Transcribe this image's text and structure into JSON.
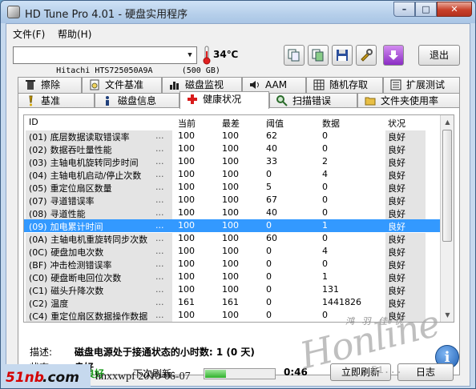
{
  "window": {
    "title": "HD Tune Pro 4.01 - 硬盘实用程序",
    "minimize": "–",
    "maximize": "□",
    "close": "✕"
  },
  "menu": {
    "file": "文件(F)",
    "help": "帮助(H)"
  },
  "toolbar": {
    "drive": "Hitachi HTS725050A9A      (500 GB)",
    "temperature": "34℃",
    "exit": "退出"
  },
  "tabs_top": [
    "擦除",
    "文件基准",
    "磁盘监视",
    "AAM",
    "随机存取",
    "扩展测试"
  ],
  "tabs_bottom": [
    "基准",
    "磁盘信息",
    "健康状况",
    "扫描错误",
    "文件夹使用率"
  ],
  "table": {
    "headers": {
      "id": "ID",
      "current": "当前",
      "worst": "最差",
      "threshold": "阈值",
      "data": "数据",
      "status": "状况"
    },
    "rows": [
      {
        "id": "(01)",
        "name": "底层数据读取错误率",
        "current": "100",
        "worst": "100",
        "threshold": "62",
        "data": "0",
        "status": "良好"
      },
      {
        "id": "(02)",
        "name": "数据吞吐量性能",
        "current": "100",
        "worst": "100",
        "threshold": "40",
        "data": "0",
        "status": "良好"
      },
      {
        "id": "(03)",
        "name": "主轴电机旋转同步时间",
        "current": "100",
        "worst": "100",
        "threshold": "33",
        "data": "2",
        "status": "良好"
      },
      {
        "id": "(04)",
        "name": "主轴电机启动/停止次数",
        "current": "100",
        "worst": "100",
        "threshold": "0",
        "data": "4",
        "status": "良好"
      },
      {
        "id": "(05)",
        "name": "重定位扇区数量",
        "current": "100",
        "worst": "100",
        "threshold": "5",
        "data": "0",
        "status": "良好"
      },
      {
        "id": "(07)",
        "name": "寻道错误率",
        "current": "100",
        "worst": "100",
        "threshold": "67",
        "data": "0",
        "status": "良好"
      },
      {
        "id": "(08)",
        "name": "寻道性能",
        "current": "100",
        "worst": "100",
        "threshold": "40",
        "data": "0",
        "status": "良好"
      },
      {
        "id": "(09)",
        "name": "加电累计时间",
        "current": "100",
        "worst": "100",
        "threshold": "0",
        "data": "1",
        "status": "良好"
      },
      {
        "id": "(0A)",
        "name": "主轴电机重旋转同步次数",
        "current": "100",
        "worst": "100",
        "threshold": "60",
        "data": "0",
        "status": "良好"
      },
      {
        "id": "(0C)",
        "name": "硬盘加电次数",
        "current": "100",
        "worst": "100",
        "threshold": "0",
        "data": "4",
        "status": "良好"
      },
      {
        "id": "(BF)",
        "name": "冲击检测错误率",
        "current": "100",
        "worst": "100",
        "threshold": "0",
        "data": "0",
        "status": "良好"
      },
      {
        "id": "(C0)",
        "name": "硬盘断电回位次数",
        "current": "100",
        "worst": "100",
        "threshold": "0",
        "data": "1",
        "status": "良好"
      },
      {
        "id": "(C1)",
        "name": "磁头升降次数",
        "current": "100",
        "worst": "100",
        "threshold": "0",
        "data": "131",
        "status": "良好"
      },
      {
        "id": "(C2)",
        "name": "温度",
        "current": "161",
        "worst": "161",
        "threshold": "0",
        "data": "1441826",
        "status": "良好"
      },
      {
        "id": "(C4)",
        "name": "重定位扇区数据操作数据",
        "current": "100",
        "worst": "100",
        "threshold": "0",
        "data": "0",
        "status": "良好"
      }
    ],
    "dots": "...",
    "selected_index": 7
  },
  "details": {
    "desc_label": "描述:",
    "desc_value": "磁盘电源处于接通状态的小时数: 1 (0 天)",
    "status_label": "状态:",
    "status_value": "良好"
  },
  "status": {
    "health_label": "健康状况:",
    "health_value": "良好",
    "refresh_label": "下次刷新:",
    "progress": 0.3,
    "time": "0:46",
    "refresh_now": "立即刷新",
    "log": "日志"
  },
  "overlay": {
    "site": "51nb.com",
    "signature": "hnxxwpf   2010-06-07",
    "wm_cn": "鸿 羽 佳 优",
    "wm_script": "Honline",
    "wm_url": "51..."
  },
  "colors": {
    "selection": "#3399ff",
    "status_ok": "#1a9a1a"
  }
}
